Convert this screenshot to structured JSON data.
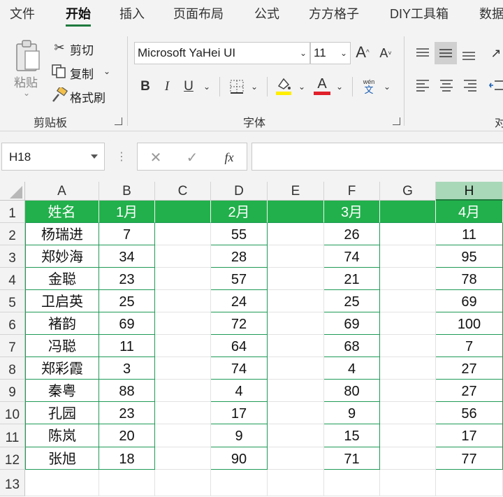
{
  "colors": {
    "accent": "#1f7a3e",
    "header_fill": "#21b04b",
    "table_border": "#1f9a57"
  },
  "tabs": [
    "文件",
    "开始",
    "插入",
    "页面布局",
    "公式",
    "方方格子",
    "DIY工具箱",
    "数据"
  ],
  "clipboard": {
    "paste": "粘贴",
    "cut": "剪切",
    "copy": "复制",
    "format_painter": "格式刷",
    "group_label": "剪贴板"
  },
  "font": {
    "name": "Microsoft YaHei UI",
    "size": "11",
    "group_label": "字体",
    "grow": "A",
    "shrink": "A",
    "bold": "B",
    "italic": "I",
    "underline": "U",
    "font_color": "A",
    "wen_top": "wén",
    "wen_bottom": "文"
  },
  "alignment": {
    "group_label_partial": "对"
  },
  "formula_bar": {
    "name_box": "H18",
    "fx": "fx",
    "formula": ""
  },
  "columns": [
    "A",
    "B",
    "C",
    "D",
    "E",
    "F",
    "G",
    "H"
  ],
  "rows": [
    "1",
    "2",
    "3",
    "4",
    "5",
    "6",
    "7",
    "8",
    "9",
    "10",
    "11",
    "12",
    "13"
  ],
  "table": {
    "headers": {
      "A": "姓名",
      "B": "1月",
      "C": "",
      "D": "2月",
      "E": "",
      "F": "3月",
      "G": "",
      "H": "4月"
    },
    "records": [
      {
        "A": "杨瑞进",
        "B": "7",
        "D": "55",
        "F": "26",
        "H": "11"
      },
      {
        "A": "郑妙海",
        "B": "34",
        "D": "28",
        "F": "74",
        "H": "95"
      },
      {
        "A": "金聪",
        "B": "23",
        "D": "57",
        "F": "21",
        "H": "78"
      },
      {
        "A": "卫启英",
        "B": "25",
        "D": "24",
        "F": "25",
        "H": "69"
      },
      {
        "A": "褚韵",
        "B": "69",
        "D": "72",
        "F": "69",
        "H": "100"
      },
      {
        "A": "冯聪",
        "B": "11",
        "D": "64",
        "F": "68",
        "H": "7"
      },
      {
        "A": "郑彩霞",
        "B": "3",
        "D": "74",
        "F": "4",
        "H": "27"
      },
      {
        "A": "秦粤",
        "B": "88",
        "D": "4",
        "F": "80",
        "H": "27"
      },
      {
        "A": "孔园",
        "B": "23",
        "D": "17",
        "F": "9",
        "H": "56"
      },
      {
        "A": "陈岚",
        "B": "20",
        "D": "9",
        "F": "15",
        "H": "17"
      },
      {
        "A": "张旭",
        "B": "18",
        "D": "90",
        "F": "71",
        "H": "77"
      }
    ]
  }
}
